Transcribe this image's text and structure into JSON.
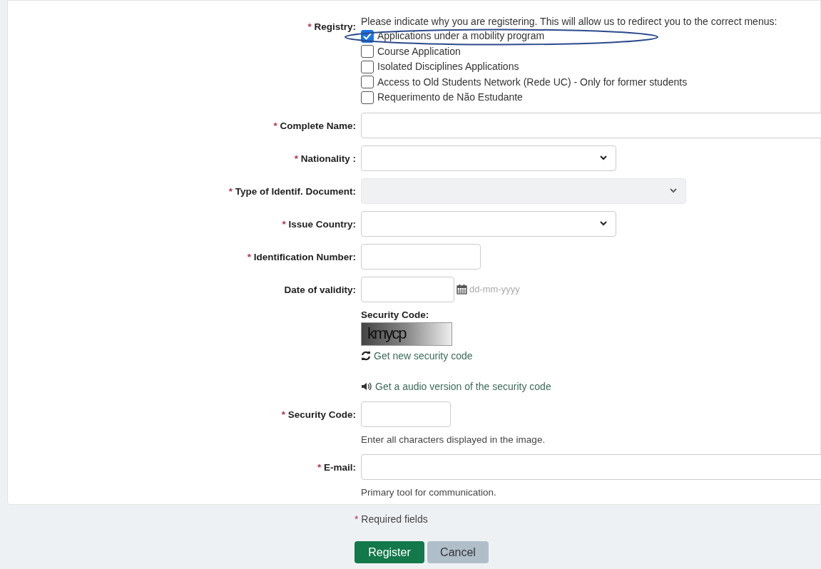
{
  "registry": {
    "label": "Registry:",
    "required": true,
    "intro": "Please indicate why you are registering. This will allow us to redirect you to the correct menus:",
    "options": [
      {
        "label": "Applications under a mobility program",
        "checked": true
      },
      {
        "label": "Course Application",
        "checked": false
      },
      {
        "label": "Isolated Disciplines Applications",
        "checked": false
      },
      {
        "label": "Access to Old Students Network (Rede UC) - Only for former students",
        "checked": false
      },
      {
        "label": "Requerimento de Não Estudante",
        "checked": false
      }
    ]
  },
  "rows": [
    {
      "kind": "text-wide",
      "label": "Complete Name:",
      "required": true
    },
    {
      "kind": "select",
      "label": "Nationality :",
      "required": true,
      "disabled": false
    },
    {
      "kind": "select-long",
      "label": "Type of Identif. Document:",
      "required": true,
      "disabled": true
    },
    {
      "kind": "select",
      "label": "Issue Country:",
      "required": true,
      "disabled": false
    },
    {
      "kind": "text-short",
      "label": "Identification Number:",
      "required": true
    },
    {
      "kind": "date",
      "label": "Date of validity:",
      "required": false,
      "placeholder": "dd-mm-yyyy"
    },
    {
      "kind": "captcha",
      "heading": "Security Code:",
      "code": "kmycp",
      "refresh": "Get new security code",
      "audio": "Get a audio version of the security code"
    },
    {
      "kind": "text-code",
      "label": "Security Code:",
      "required": true,
      "hint": "Enter all characters displayed in the image."
    },
    {
      "kind": "text-wide",
      "label": "E-mail:",
      "required": true,
      "hint": "Primary tool for communication."
    }
  ],
  "required_note": {
    "mark": "*",
    "text": "Required fields"
  },
  "buttons": [
    {
      "kind": "primary",
      "label": "Register"
    },
    {
      "kind": "secondary",
      "label": "Cancel"
    }
  ]
}
